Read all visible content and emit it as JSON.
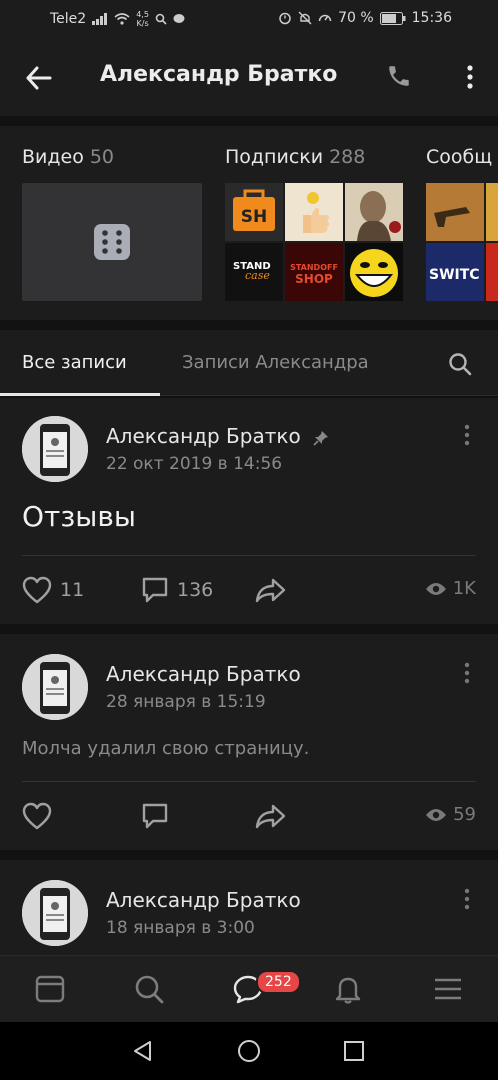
{
  "status": {
    "carrier": "Tele2",
    "speed_value": "4,5",
    "speed_unit": "K/s",
    "battery": "70 %",
    "time": "15:36"
  },
  "header": {
    "title": "Александр Братко"
  },
  "media": {
    "video_label": "Видео",
    "video_count": "50",
    "subs_label": "Подписки",
    "subs_count": "288",
    "comm_label": "Сообщ"
  },
  "tabs": {
    "all": "Все записи",
    "own": "Записи Александра"
  },
  "posts": [
    {
      "author": "Александр Братко",
      "date": "22 окт 2019 в 14:56",
      "text": "Отзывы",
      "likes": "11",
      "comments": "136",
      "views": "1K"
    },
    {
      "author": "Александр Братко",
      "date": "28 января в 15:19",
      "text": "Молча удалил свою страницу.",
      "likes": "",
      "comments": "",
      "views": "59"
    },
    {
      "author": "Александр Братко",
      "date": "18 января в 3:00"
    }
  ],
  "nav": {
    "badge": "252"
  }
}
